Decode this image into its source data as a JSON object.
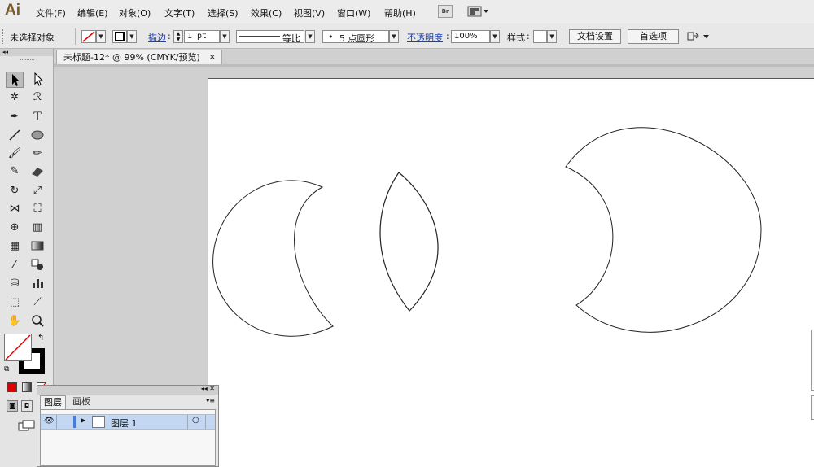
{
  "app": {
    "logo": "Ai"
  },
  "menu": [
    "文件(F)",
    "编辑(E)",
    "对象(O)",
    "文字(T)",
    "选择(S)",
    "效果(C)",
    "视图(V)",
    "窗口(W)",
    "帮助(H)"
  ],
  "menubar_extra": {
    "bridge_label": "Br"
  },
  "control": {
    "selection_status": "未选择对象",
    "stroke_label": "描边",
    "stroke_weight": "1 pt",
    "profile_label": "等比",
    "brush_label": "5 点圆形",
    "opacity_label": "不透明度",
    "opacity_value": "100%",
    "style_label": "样式",
    "doc_setup": "文档设置",
    "preferences": "首选项"
  },
  "document": {
    "tab_title": "未标题-12* @ 99% (CMYK/预览)",
    "tab_close": "×"
  },
  "layers_panel": {
    "tabs": [
      "图层",
      "画板"
    ],
    "layer_name": "图层 1",
    "header_controls": "◂◂ ✕"
  },
  "colors": {
    "accent_link": "#1a3fb5",
    "layer_row": "#c3d7f2"
  }
}
